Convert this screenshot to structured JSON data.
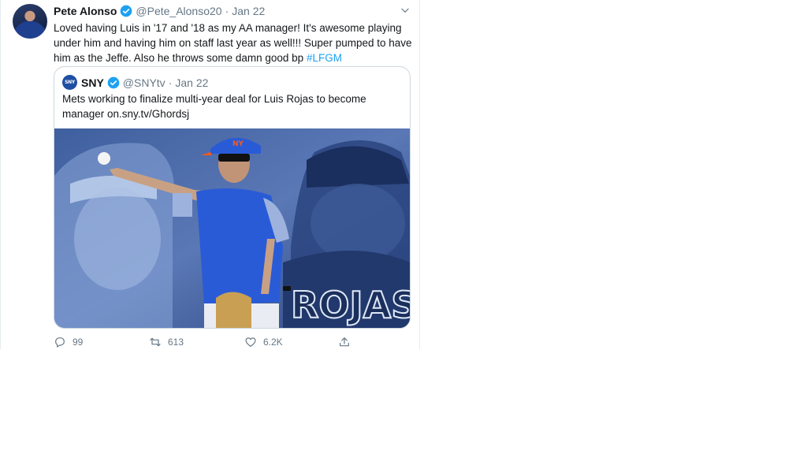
{
  "tweet": {
    "name": "Pete Alonso",
    "handle": "@Pete_Alonso20",
    "separator": "·",
    "date": "Jan 22",
    "text_line1": "Loved having Luis in '17 and '18 as my AA manager! It's awesome playing",
    "text_line2": "under him and having him on staff last year as well!!! Super pumped to have",
    "text_line3_pre": "him as the Jeffe. Also he throws some damn good bp ",
    "hashtag": "#LFGM"
  },
  "quote": {
    "logo_text": "SNY",
    "name": "SNY",
    "handle": "@SNYtv",
    "separator": "·",
    "date": "Jan 22",
    "text_line1": "Mets working to finalize multi-year deal for Luis Rojas to become",
    "text_line2": "manager on.sny.tv/Ghordsj",
    "image_text": "ROJAS"
  },
  "actions": {
    "replies": "99",
    "retweets": "613",
    "likes": "6.2K"
  },
  "colors": {
    "accent": "#1da1f2",
    "muted": "#657786",
    "mets_blue": "#2a5bd7",
    "mets_orange": "#ff5910"
  },
  "icons": [
    "avatar",
    "verified-badge-icon",
    "chevron-down-icon",
    "reply-icon",
    "retweet-icon",
    "like-icon",
    "share-icon"
  ]
}
